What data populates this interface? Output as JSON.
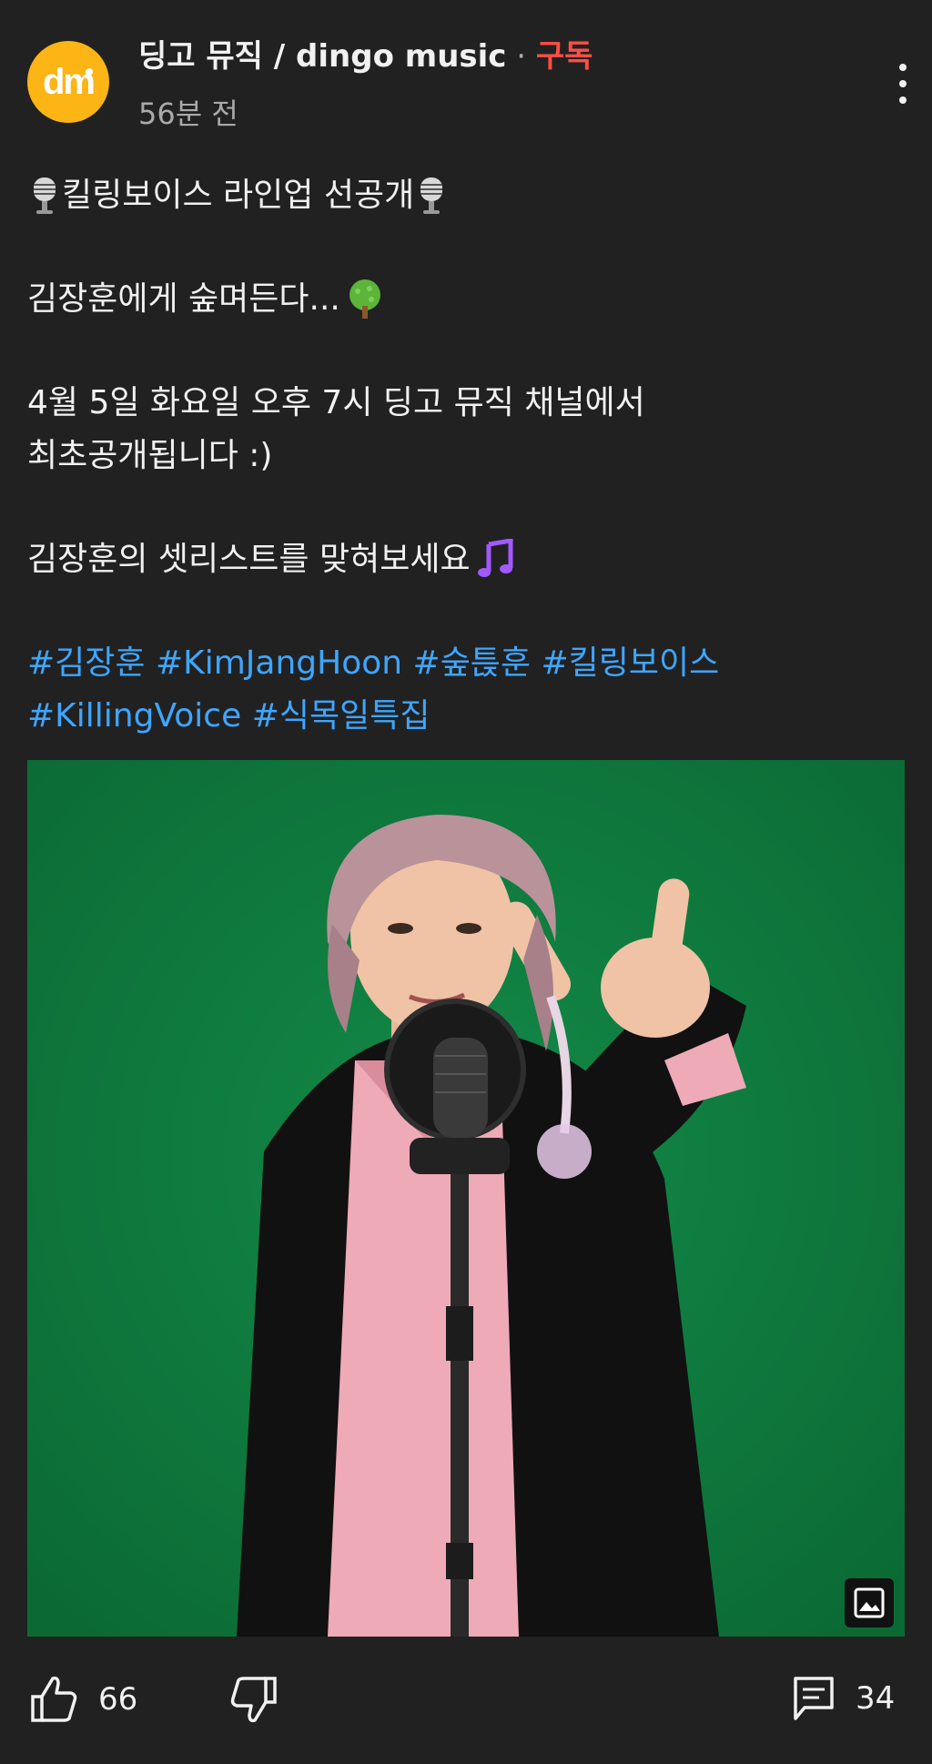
{
  "post": {
    "channel_name": "딩고 뮤직 / dingo music",
    "separator": "·",
    "subscribe_label": "구독",
    "time_ago": "56분 전",
    "avatar_text": "dm",
    "line1": "킬링보이스 라인업 선공개",
    "line2": "김장훈에게 숲며든다...",
    "line3": "4월 5일 화요일 오후 7시 딩고 뮤직 채널에서",
    "line4": "최초공개됩니다 :)",
    "line5": "김장훈의 셋리스트를 맞혀보세요",
    "hashtags_line1": "#김장훈 #KimJangHoon #숲튽훈 #킬링보이스",
    "hashtags_line2": "#KillingVoice #식목일특집"
  },
  "actions": {
    "likes": "66",
    "comments": "34"
  },
  "colors": {
    "background": "#212121",
    "subscribe": "#ff4e45",
    "hashtag": "#3ea6ff",
    "avatar": "#fdb515",
    "photo_bg": "#0e7a3d"
  },
  "icons": [
    "more-vert-icon",
    "microphone-icon",
    "tree-icon",
    "music-note-icon",
    "image-icon",
    "thumbs-up-icon",
    "thumbs-down-icon",
    "comment-icon"
  ]
}
